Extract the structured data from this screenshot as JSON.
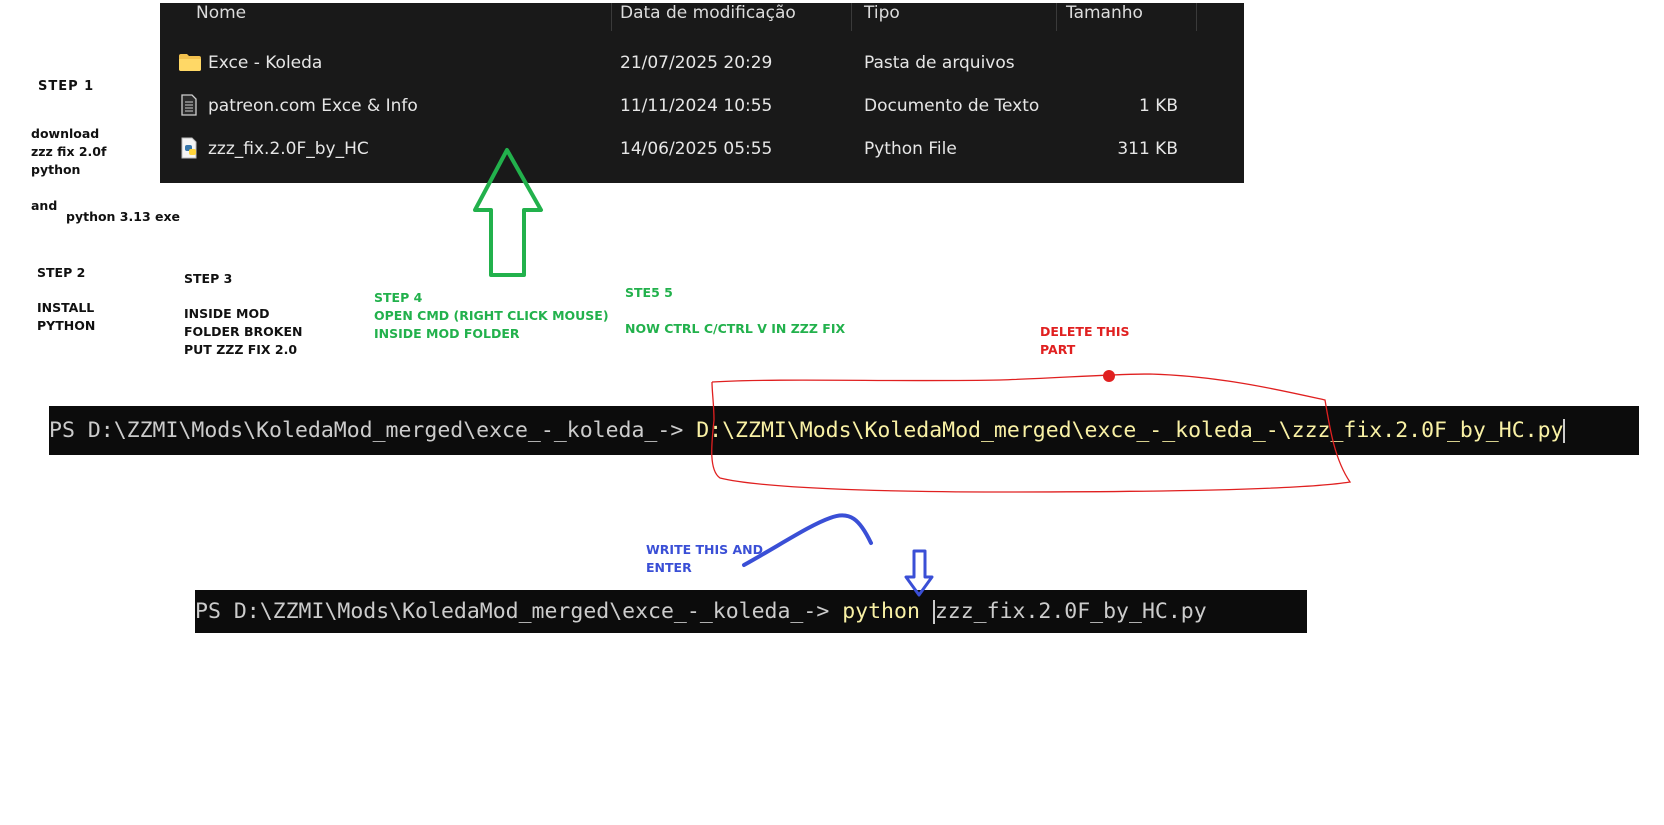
{
  "explorer": {
    "columns": [
      "Nome",
      "Data de modificação",
      "Tipo",
      "Tamanho"
    ],
    "rows": [
      {
        "icon": "folder-icon",
        "name": "Exce - Koleda",
        "date": "21/07/2025 20:29",
        "type": "Pasta de arquivos",
        "size": ""
      },
      {
        "icon": "text-document-icon",
        "name": "patreon.com Exce & Info",
        "date": "11/11/2024 10:55",
        "type": "Documento de Texto",
        "size": "1 KB"
      },
      {
        "icon": "python-file-icon",
        "name": "zzz_fix.2.0F_by_HC",
        "date": "14/06/2025 05:55",
        "type": "Python File",
        "size": "311 KB"
      }
    ]
  },
  "steps": {
    "step1_title": "STEP 1",
    "step1_text": "download\nzzz fix 2.0f\npython",
    "step1_and": "and",
    "step1_python": "python 3.13 exe",
    "step2_title": "STEP 2",
    "step2_text": "INSTALL\nPYTHON",
    "step3_title": "STEP 3",
    "step3_text": "INSIDE MOD\nFOLDER BROKEN\nPUT ZZZ FIX 2.0",
    "step4_text": "STEP 4\nOPEN CMD (RIGHT CLICK MOUSE)\nINSIDE MOD FOLDER",
    "step5_title": "STE5 5",
    "step5_text": "NOW CTRL C/CTRL V IN ZZZ FIX",
    "delete_note": "DELETE THIS\nPART",
    "write_note": "WRITE THIS AND\nENTER"
  },
  "terminal1": {
    "prompt": "PS D:\\ZZMI\\Mods\\KoledaMod_merged\\exce_-_koleda_-> ",
    "command": "D:\\ZZMI\\Mods\\KoledaMod_merged\\exce_-_koleda_-\\zzz_fix.2.0F_by_HC.py"
  },
  "terminal2": {
    "prompt": "PS D:\\ZZMI\\Mods\\KoledaMod_merged\\exce_-_koleda_-> ",
    "command": "python",
    "argument": "zzz_fix.2.0F_by_HC.py"
  },
  "colors": {
    "green_annotation": "#22b14c",
    "red_annotation": "#e02020",
    "blue_annotation": "#3a4fd6",
    "terminal_bg": "#0c0c0c",
    "explorer_bg": "#191919"
  }
}
